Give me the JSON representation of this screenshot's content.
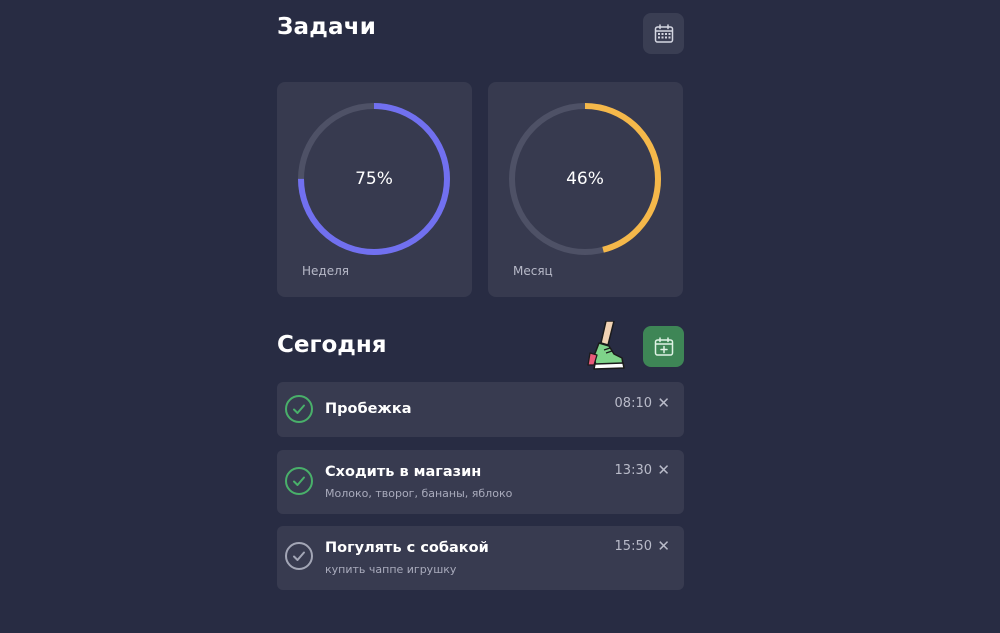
{
  "header": {
    "title": "Задачи",
    "calendar_icon": "calendar-icon"
  },
  "stats": [
    {
      "label": "Неделя",
      "percent_text": "75%",
      "progress": 0.75,
      "color": "#7170f0"
    },
    {
      "label": "Месяц",
      "percent_text": "46%",
      "progress": 0.46,
      "color": "#f5b84a"
    }
  ],
  "today": {
    "title": "Сегодня",
    "add_icon": "calendar-add-icon",
    "illustration": "running-legs-sneakers-icon"
  },
  "tasks": [
    {
      "title": "Пробежка",
      "subtitle": "",
      "time": "08:10",
      "done": true,
      "close": "✕"
    },
    {
      "title": "Сходить в магазин",
      "subtitle": "Молоко, творог, бананы, яблоко",
      "time": "13:30",
      "done": true,
      "close": "✕"
    },
    {
      "title": "Погулять с собакой",
      "subtitle": "купить чаппе игрушку",
      "time": "15:50",
      "done": false,
      "close": "✕"
    }
  ],
  "colors": {
    "background": "#282c43",
    "card": "#373a4f",
    "ring_track": "#4e5166",
    "check_done": "#49b06a",
    "check_todo": "#a3a6b6",
    "add_button": "#3e8656"
  }
}
